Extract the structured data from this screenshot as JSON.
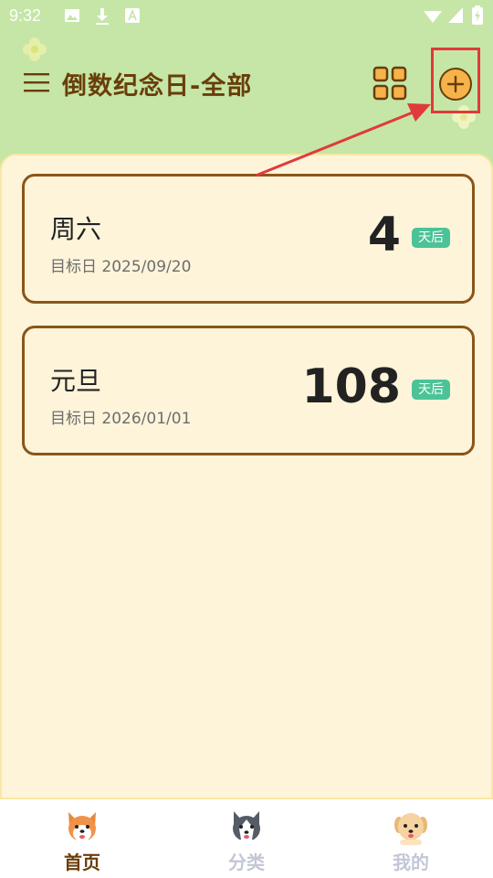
{
  "status_bar": {
    "time": "9:32"
  },
  "header": {
    "title": "倒数纪念日-全部"
  },
  "events": [
    {
      "name": "周六",
      "date_label": "目标日 2025/09/20",
      "days": "4",
      "badge": "天后"
    },
    {
      "name": "元旦",
      "date_label": "目标日 2026/01/01",
      "days": "108",
      "badge": "天后"
    }
  ],
  "bottom_nav": [
    {
      "label": "首页",
      "icon": "corgi-icon",
      "active": true
    },
    {
      "label": "分类",
      "icon": "husky-icon",
      "active": false
    },
    {
      "label": "我的",
      "icon": "golden-dog-icon",
      "active": false
    }
  ],
  "colors": {
    "header_bg": "#c5e6a6",
    "content_bg": "#fef4da",
    "accent": "#f6b34a",
    "card_border": "#8a5619",
    "badge": "#4cc397",
    "highlight": "#e03a3a"
  }
}
